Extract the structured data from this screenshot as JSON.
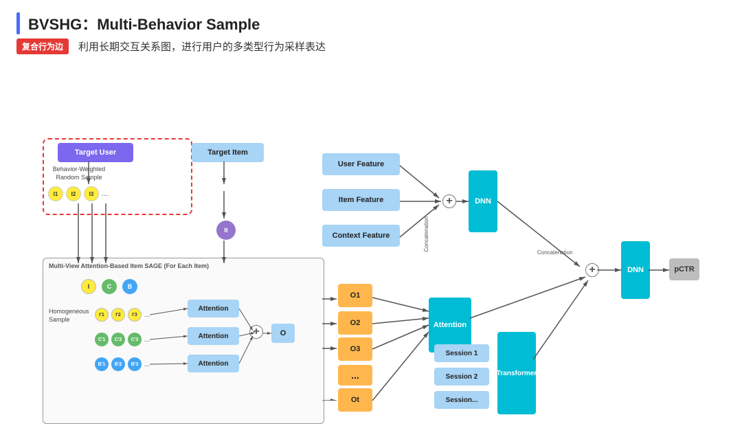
{
  "header": {
    "title": "BVSHG：Multi-Behavior Sample",
    "bar_color": "#4a6cf7"
  },
  "subtitle": {
    "badge": "复合行为边",
    "text": "利用长期交互关系图，进行用户的多类型行为采样表达"
  },
  "diagram": {
    "target_user_label": "Target User",
    "target_item_label": "Target Item",
    "behavior_sample_label": "Behavior-Weighted\nRandom Sample",
    "item_labels": [
      "I1",
      "I2",
      "I3",
      "..."
    ],
    "it_label": "It",
    "user_feature_label": "User Feature",
    "item_feature_label": "Item Feature",
    "context_feature_label": "Context Feature",
    "concatenation_label": "Concatenation",
    "dnn_label": "DNN",
    "dnn2_label": "DNN",
    "pCTR_label": "pCTR",
    "attention_label": "Attention",
    "multiview_label": "Multi-View Attention-Based Item SAGE (For Each Item)",
    "homogeneous_label": "Homogeneous\nSample",
    "attention1_label": "Attention",
    "attention2_label": "Attention",
    "attention3_label": "Attention",
    "o_label": "O",
    "o1_label": "O1",
    "o2_label": "O2",
    "o3_label": "O3",
    "ot_label": "Ot",
    "dots_label": "...",
    "session1_label": "Session 1",
    "session2_label": "Session 2",
    "sessiondots_label": "Session...",
    "transformer_label": "Transformer",
    "i_circle": "I",
    "c_circle": "C",
    "b_circle": "B",
    "i1_prime": "I'1",
    "i2_prime": "I'2",
    "i3_prime": "I'3",
    "c1_prime": "C'1",
    "c2_prime": "C'2",
    "c3_prime": "C'3",
    "b1_prime": "B'1",
    "b2_prime": "B'2",
    "b3_prime": "B'3"
  }
}
